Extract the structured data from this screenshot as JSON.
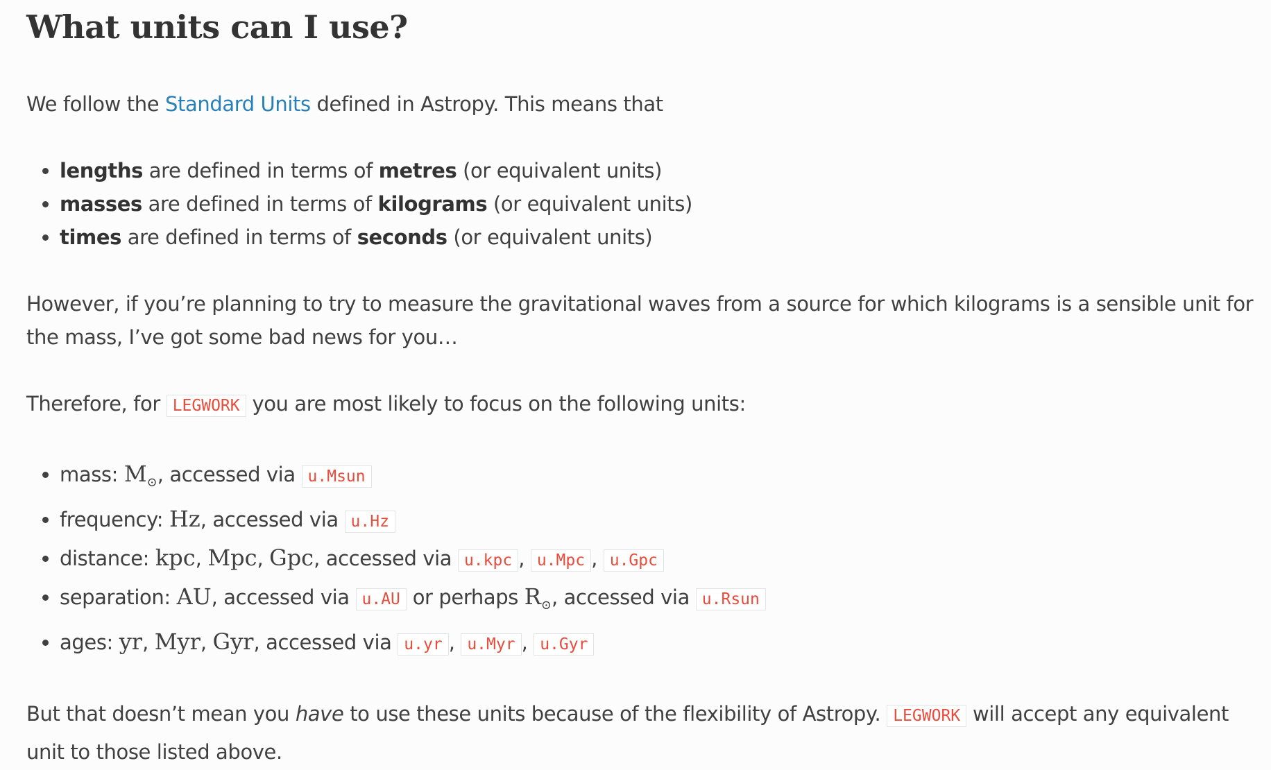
{
  "heading": "What units can I use?",
  "intro": {
    "before_link": "We follow the ",
    "link_text": "Standard Units",
    "after_link": " defined in Astropy. This means that"
  },
  "definitions": [
    {
      "term": "lengths",
      "middle": " are defined in terms of ",
      "unit": "metres",
      "tail": " (or equivalent units)"
    },
    {
      "term": "masses",
      "middle": " are defined in terms of ",
      "unit": "kilograms",
      "tail": " (or equivalent units)"
    },
    {
      "term": "times",
      "middle": " are defined in terms of ",
      "unit": "seconds",
      "tail": " (or equivalent units)"
    }
  ],
  "however": "However, if you’re planning to try to measure the gravitational waves from a source for which kilograms is a sensible unit for the mass, I’ve got some bad news for you…",
  "therefore": {
    "before": "Therefore, for ",
    "code": "LEGWORK",
    "after": " you are most likely to focus on the following units:"
  },
  "units": {
    "mass": {
      "label": "mass: ",
      "sym": "M",
      "sun": "⊙",
      "accessed": ", accessed via ",
      "code": "u.Msun"
    },
    "frequency": {
      "label": "frequency: ",
      "sym": "Hz",
      "accessed": ", accessed via ",
      "code": "u.Hz"
    },
    "distance": {
      "label": "distance: ",
      "syms": [
        "kpc",
        "Mpc",
        "Gpc"
      ],
      "sep": ", ",
      "accessed": ", accessed via ",
      "codes": [
        "u.kpc",
        "u.Mpc",
        "u.Gpc"
      ],
      "code_sep": ", "
    },
    "separation": {
      "label": "separation: ",
      "sym": "AU",
      "accessed": ", accessed via ",
      "code": "u.AU",
      "middle": " or perhaps ",
      "sym2": "R",
      "sun": "⊙",
      "accessed2": ", accessed via ",
      "code2": "u.Rsun"
    },
    "ages": {
      "label": "ages: ",
      "syms": [
        "yr",
        "Myr",
        "Gyr"
      ],
      "sep": ", ",
      "accessed": ", accessed via ",
      "codes": [
        "u.yr",
        "u.Myr",
        "u.Gyr"
      ],
      "code_sep": ", "
    }
  },
  "closing": {
    "before": "But that doesn’t mean you ",
    "emph": "have",
    "mid": " to use these units because of the flexibility of Astropy. ",
    "code": "LEGWORK",
    "after": " will accept any equivalent unit to those listed above."
  },
  "colors": {
    "link": "#2980b9",
    "code_text": "#e74c3c",
    "text": "#404040",
    "background": "#fcfcfc"
  }
}
